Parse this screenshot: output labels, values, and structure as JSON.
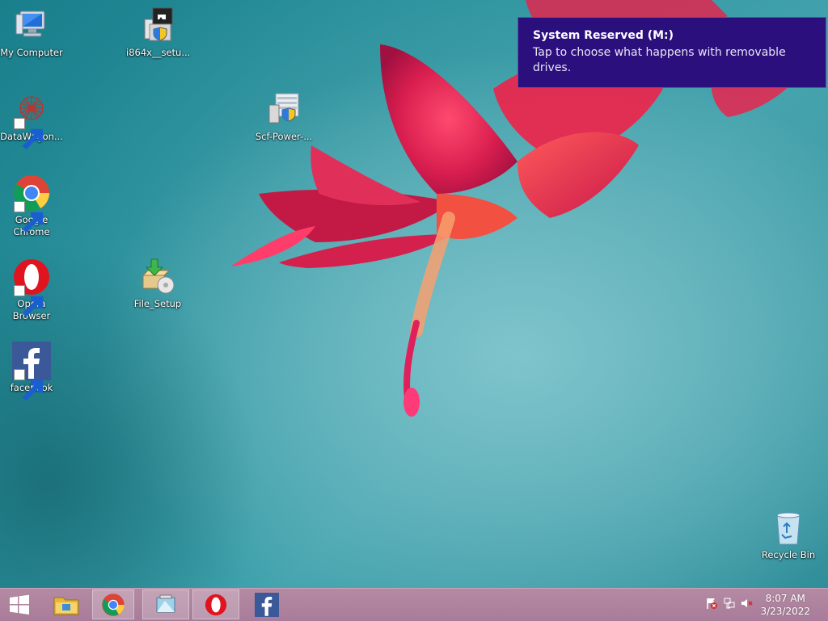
{
  "desktop": {
    "icons": [
      {
        "label": "My Computer",
        "icon": "computer-icon"
      },
      {
        "label": "i864x__setu...",
        "icon": "installer-icon"
      },
      {
        "label": "DataWagon...",
        "icon": "datawagon-icon"
      },
      {
        "label": "Scf-Power-...",
        "icon": "scf-power-icon"
      },
      {
        "label": "Google Chrome",
        "icon": "chrome-icon"
      },
      {
        "label": "Opera Browser",
        "icon": "opera-icon"
      },
      {
        "label": "File_Setup",
        "icon": "file-setup-icon"
      },
      {
        "label": "facebook",
        "icon": "facebook-icon"
      },
      {
        "label": "Recycle Bin",
        "icon": "recycle-bin-icon"
      }
    ]
  },
  "notification": {
    "title": "System Reserved (M:)",
    "message": "Tap to choose what happens with removable drives."
  },
  "taskbar": {
    "items": [
      "start-icon",
      "file-explorer-icon",
      "chrome-icon",
      "app-icon",
      "opera-icon",
      "facebook-icon"
    ],
    "tray": [
      "action-center-flag-icon",
      "network-icon",
      "volume-muted-icon"
    ],
    "time": "8:07 AM",
    "date": "3/23/2022"
  },
  "colors": {
    "notification_bg": "#2b0f7c",
    "taskbar_bg": "#ad7f9c",
    "desktop_bg": "#2b95a0"
  }
}
